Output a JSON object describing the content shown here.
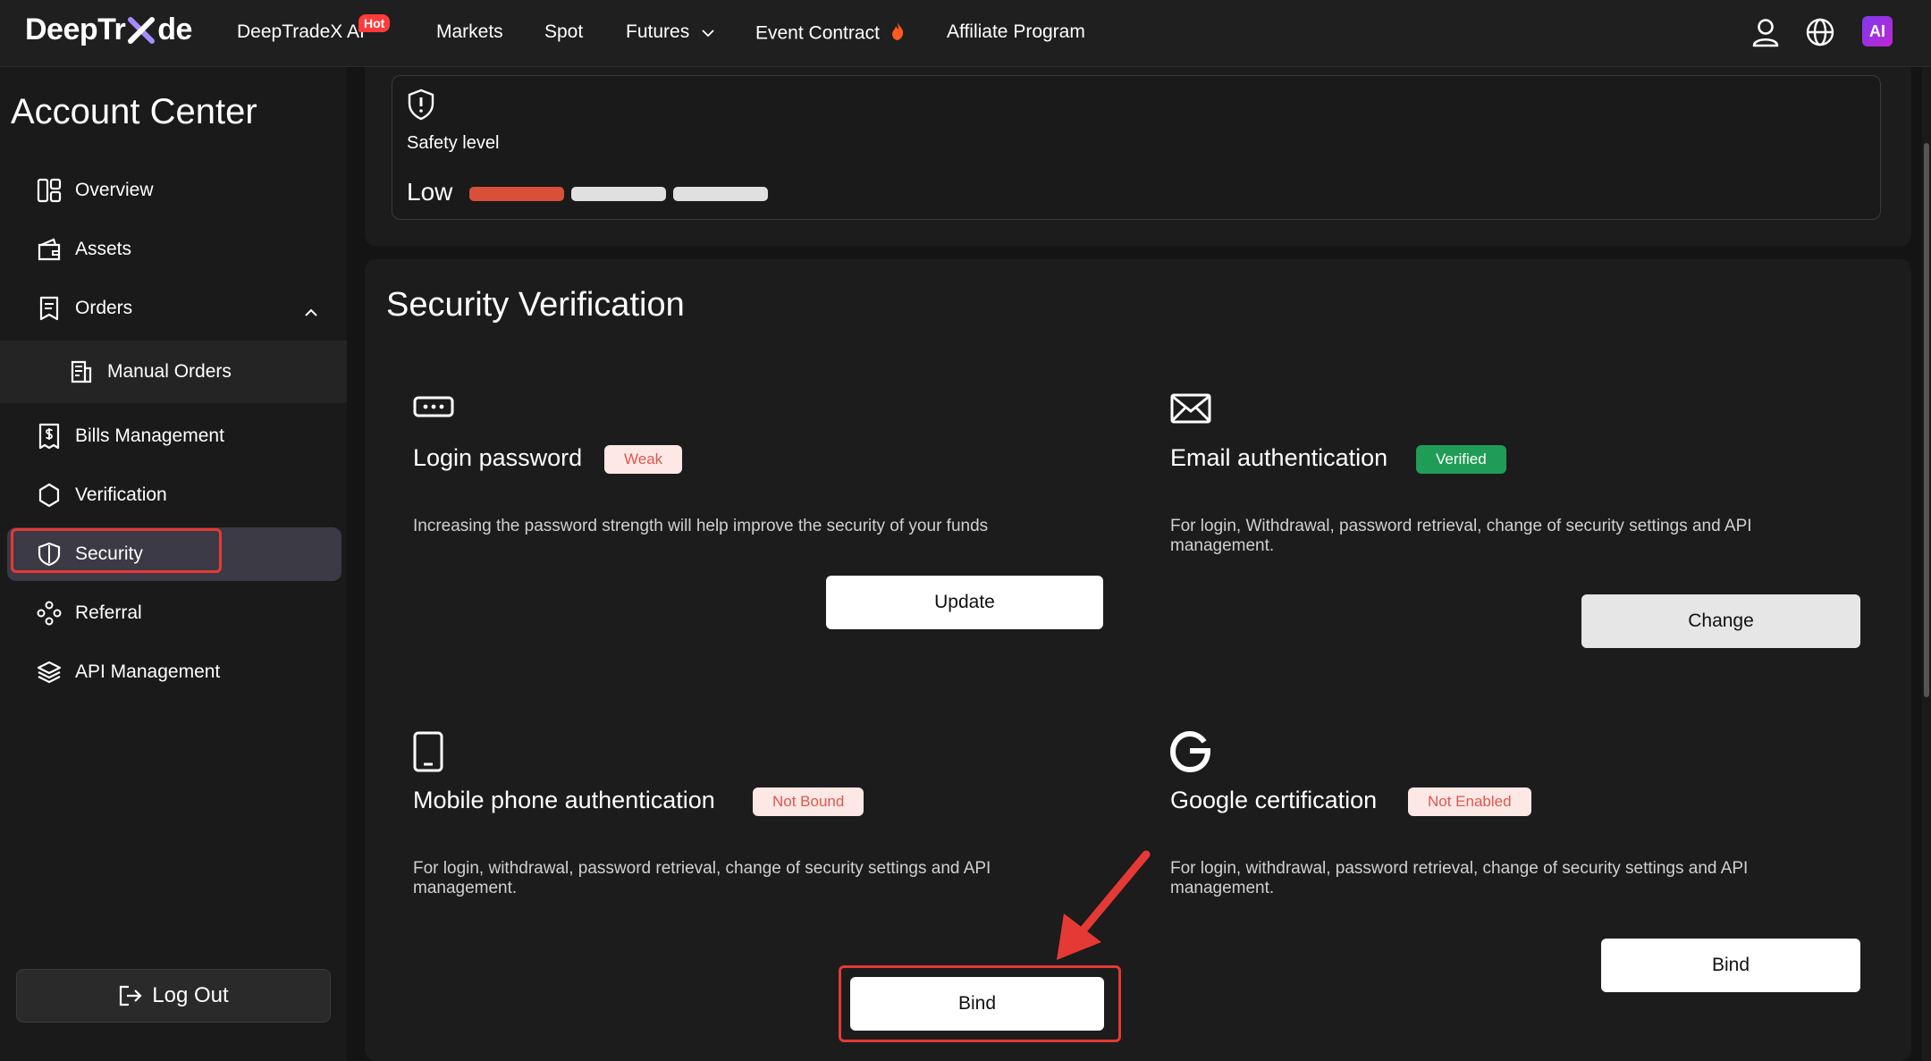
{
  "nav": {
    "logo": "DeepTrade",
    "logo_parts": [
      "DeepTr",
      "de"
    ],
    "items": [
      {
        "label": "DeepTradeX AI",
        "badge": "Hot"
      },
      {
        "label": "Markets"
      },
      {
        "label": "Spot"
      },
      {
        "label": "Futures"
      },
      {
        "label": "Event Contract"
      },
      {
        "label": "Affiliate Program"
      }
    ],
    "ai_badge": "AI"
  },
  "sidebar": {
    "title": "Account Center",
    "items": [
      {
        "label": "Overview",
        "icon": "overview-icon"
      },
      {
        "label": "Assets",
        "icon": "wallet-icon"
      },
      {
        "label": "Orders",
        "icon": "orders-icon"
      },
      {
        "label": "Manual Orders",
        "icon": "manual-orders-icon"
      },
      {
        "label": "Bills Management",
        "icon": "bills-icon"
      },
      {
        "label": "Verification",
        "icon": "verification-icon"
      },
      {
        "label": "Security",
        "icon": "shield-icon",
        "active": true
      },
      {
        "label": "Referral",
        "icon": "referral-icon"
      },
      {
        "label": "API Management",
        "icon": "layers-icon"
      }
    ],
    "logout": "Log Out"
  },
  "safety": {
    "label": "Safety level",
    "level": "Low",
    "level_value": 1,
    "level_max": 3,
    "colors": {
      "active": "#d9503a",
      "inactive": "#e0e0e0"
    }
  },
  "security": {
    "title": "Security Verification",
    "items": [
      {
        "title": "Login password",
        "status": "Weak",
        "desc": "Increasing the password strength will help improve the security of your funds",
        "button": "Update"
      },
      {
        "title": "Email authentication",
        "status": "Verified",
        "desc": "For login, Withdrawal, password retrieval, change of security settings and API management.",
        "button": "Change"
      },
      {
        "title": "Mobile phone authentication",
        "status": "Not Bound",
        "desc": "For login, withdrawal, password retrieval, change of security settings and API management.",
        "button": "Bind"
      },
      {
        "title": "Google certification",
        "status": "Not Enabled",
        "desc": "For login, withdrawal, password retrieval, change of security settings and API management.",
        "button": "Bind"
      }
    ]
  }
}
